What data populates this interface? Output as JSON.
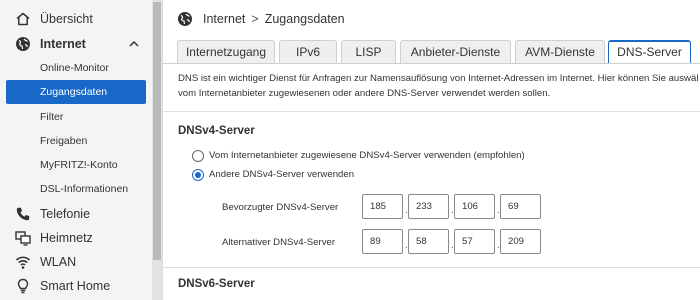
{
  "sidebar": {
    "items": [
      {
        "label": "Übersicht",
        "icon": "home-icon"
      },
      {
        "label": "Internet",
        "icon": "globe-icon",
        "expanded": true
      },
      {
        "label": "Online-Monitor"
      },
      {
        "label": "Zugangsdaten",
        "active": true
      },
      {
        "label": "Filter"
      },
      {
        "label": "Freigaben"
      },
      {
        "label": "MyFRITZ!-Konto"
      },
      {
        "label": "DSL-Informationen"
      },
      {
        "label": "Telefonie",
        "icon": "phone-icon"
      },
      {
        "label": "Heimnetz",
        "icon": "network-icon"
      },
      {
        "label": "WLAN",
        "icon": "wifi-icon"
      },
      {
        "label": "Smart Home",
        "icon": "lightbulb-icon"
      }
    ]
  },
  "breadcrumb": {
    "section": "Internet",
    "separator": ">",
    "page": "Zugangsdaten"
  },
  "tabs": [
    {
      "label": "Internetzugang"
    },
    {
      "label": "IPv6"
    },
    {
      "label": "LISP"
    },
    {
      "label": "Anbieter-Dienste"
    },
    {
      "label": "AVM-Dienste"
    },
    {
      "label": "DNS-Server",
      "active": true
    }
  ],
  "intro": {
    "line1": "DNS ist ein wichtiger Dienst für Anfragen zur Namensauflösung von Internet-Adressen im Internet. Hier können Sie auswählen",
    "line2": "vom Internetanbieter zugewiesenen oder andere DNS-Server verwendet werden sollen."
  },
  "dnsv4": {
    "heading": "DNSv4-Server",
    "option_provider": "Vom Internetanbieter zugewiesene DNSv4-Server verwenden (empfohlen)",
    "option_other": "Andere DNSv4-Server verwenden",
    "selected": "other",
    "preferred": {
      "label": "Bevorzugter DNSv4-Server",
      "octets": [
        "185",
        "233",
        "106",
        "69"
      ]
    },
    "alternate": {
      "label": "Alternativer DNSv4-Server",
      "octets": [
        "89",
        "58",
        "57",
        "209"
      ]
    }
  },
  "dnsv6": {
    "heading": "DNSv6-Server"
  },
  "colors": {
    "accent": "#1868c7",
    "sidebar_bg": "#f4f4f4"
  }
}
